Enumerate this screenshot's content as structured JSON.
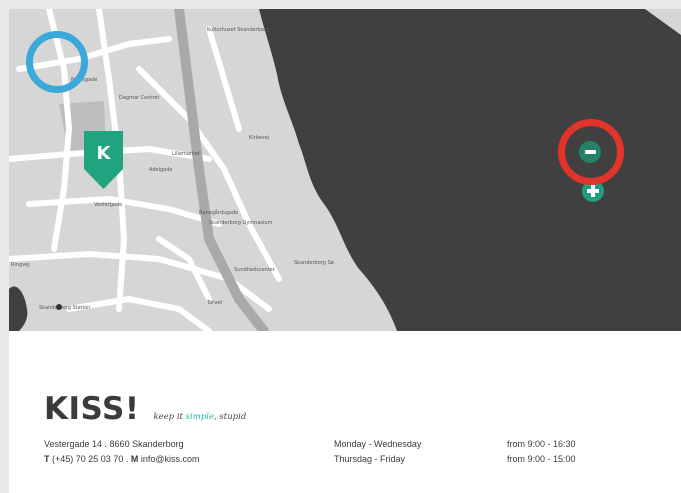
{
  "map": {
    "street_labels": [
      "Kulturhuset Skanderborg",
      "Dagmar Centret",
      "Lillemarket",
      "Adelgade",
      "Banegårdsgade",
      "Kirkevej",
      "Sundhedscenter",
      "Skanderborg Gymnasium",
      "Skanderborg Sø",
      "Torvet",
      "Vestergade",
      "Ringvej",
      "Nørregade",
      "Skanderborg Station"
    ],
    "marker_letter": "K",
    "zoom_out_icon": "minus-icon",
    "zoom_in_icon": "plus-icon",
    "colors": {
      "marker": "#20a47f",
      "zoom_button": "#1f9e80",
      "lake": "#404040",
      "land": "#d6d6d6",
      "highlight_blue": "#3aa8d8",
      "highlight_red": "#e3342b"
    }
  },
  "brand": {
    "name": "KISS!",
    "tagline_pre": "keep it ",
    "tagline_accent": "simple",
    "tagline_post": ", stupid",
    "accent_color": "#1fb7a8"
  },
  "contact": {
    "address": "Vestergade 14 . 8660 Skanderborg",
    "phone_label": "T",
    "phone": "(+45) 70 25 03 70 . ",
    "mail_label": "M",
    "email": "info@kiss.com"
  },
  "hours": [
    {
      "days": "Monday - Wednesday",
      "time": "from 9:00 - 16:30"
    },
    {
      "days": "Thursdag - Friday",
      "time": "from 9:00 - 15:00"
    }
  ]
}
